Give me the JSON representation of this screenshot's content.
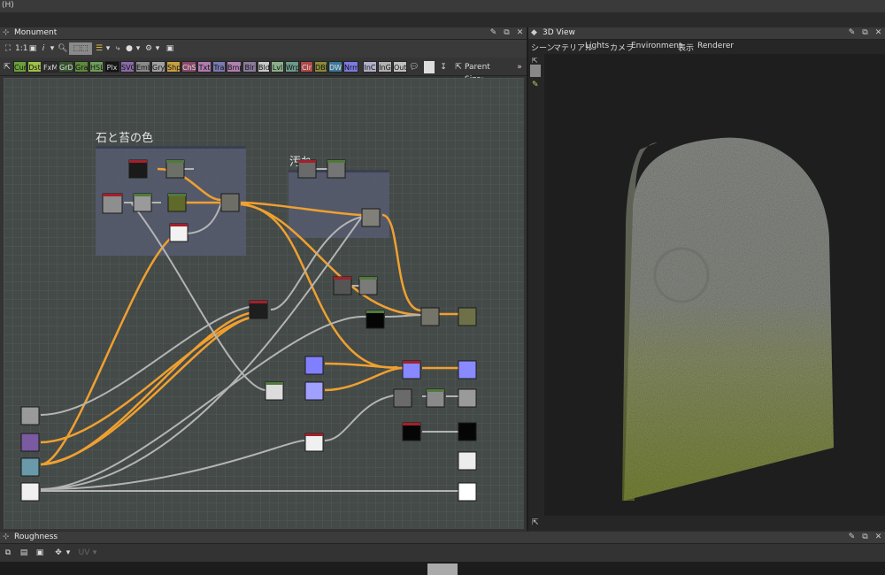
{
  "menubar": {
    "text": "(H)"
  },
  "monument": {
    "title": "Monument",
    "icon": "node-graph-icon",
    "toolbar": {
      "zoom_label": "1:1",
      "info_label": "i"
    },
    "filters": [
      {
        "label": "Cur",
        "color": "#6aa03a"
      },
      {
        "label": "Dst",
        "color": "#9fc04a"
      },
      {
        "label": "FxM",
        "color": "#2e2e2e"
      },
      {
        "label": "GrD",
        "color": "#36552e"
      },
      {
        "label": "Gra",
        "color": "#5c8a3c"
      },
      {
        "label": "HSL",
        "color": "#6f9e5a"
      },
      {
        "label": "Plx",
        "color": "#151515"
      },
      {
        "label": "SVG",
        "color": "#8a6aa8"
      },
      {
        "label": "Emb",
        "color": "#8a8a8a"
      },
      {
        "label": "Gry",
        "color": "#a0a0a0"
      },
      {
        "label": "Shp",
        "color": "#c8a040"
      },
      {
        "label": "ChS",
        "color": "#8a4a6a"
      },
      {
        "label": "Txt",
        "color": "#b07ab0"
      },
      {
        "label": "Tra",
        "color": "#7a7ab0"
      },
      {
        "label": "Bmp",
        "color": "#b080b0"
      },
      {
        "label": "Blr",
        "color": "#8a7a9a"
      },
      {
        "label": "Bld",
        "color": "#c8c8c8"
      },
      {
        "label": "Lvl",
        "color": "#8ab08a"
      },
      {
        "label": "Wrp",
        "color": "#6a9a8a"
      },
      {
        "label": "Clr",
        "color": "#b04a4a"
      },
      {
        "label": "DBl",
        "color": "#8a8a3a"
      },
      {
        "label": "DWr",
        "color": "#3a7a9a"
      },
      {
        "label": "Nrm",
        "color": "#7a7ae0"
      },
      {
        "label": "InC",
        "color": "#b0b0c8"
      },
      {
        "label": "InG",
        "color": "#b0b0b0"
      },
      {
        "label": "Out",
        "color": "#c0c0c0"
      }
    ],
    "parent_size_label": "Parent Size:",
    "frames": [
      {
        "label": "石と苔の色"
      },
      {
        "label": "汚れ"
      }
    ]
  },
  "view3d": {
    "title": "3D View",
    "menu": [
      "シーン",
      "マテリアル",
      "Lights",
      "カメラ",
      "Environment",
      "表示",
      "Renderer"
    ],
    "colors": {
      "stone_top": "#8e918c",
      "moss_bottom": "#7d8a38",
      "background": "#1e1e1e"
    }
  },
  "roughness": {
    "title": "Roughness",
    "uv_label": "UV"
  },
  "colors": {
    "wire_orange": "#f0a030",
    "wire_gray": "#b4b4b4",
    "frame_fill": "#565c70",
    "node_header_red": "#a3202a",
    "node_header_green": "#4f7a3c"
  }
}
